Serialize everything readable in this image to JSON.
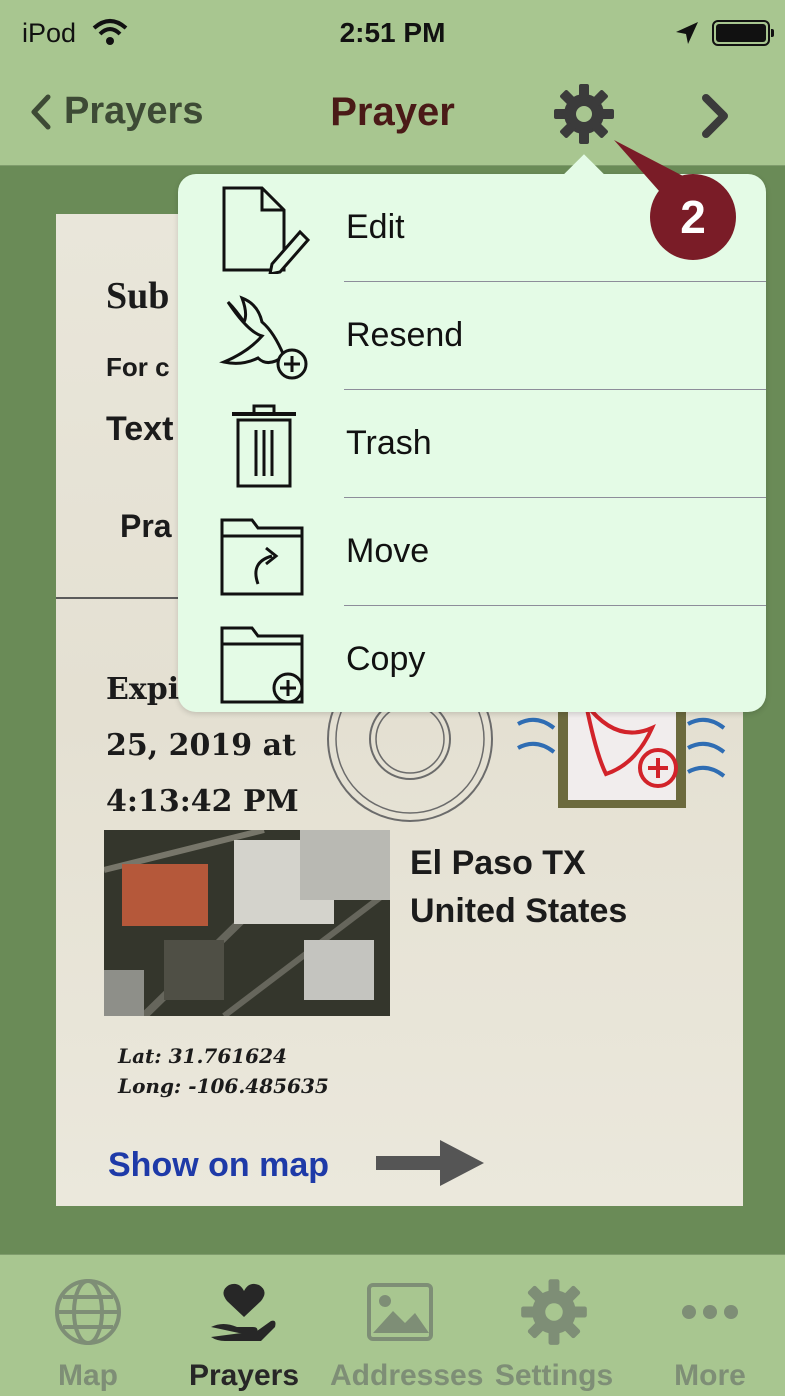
{
  "status": {
    "carrier": "iPod",
    "time": "2:51 PM"
  },
  "nav": {
    "back_label": "Prayers",
    "title": "Prayer"
  },
  "card": {
    "subject_label": "Sub",
    "for_label": "For c",
    "text_label": "Text",
    "prayer_label": "Pra",
    "expiry_line1": "Expi",
    "expiry_line2": "25, 2019 at",
    "expiry_line3": "4:13:42 PM",
    "place_line1": "El Paso TX",
    "place_line2": "United States",
    "lat": "Lat: 31.761624",
    "long": "Long: -106.485635",
    "show_on_map": "Show on map"
  },
  "menu": {
    "items": [
      {
        "label": "Edit",
        "icon": "edit-icon"
      },
      {
        "label": "Resend",
        "icon": "dove-plus-icon"
      },
      {
        "label": "Trash",
        "icon": "trash-icon"
      },
      {
        "label": "Move",
        "icon": "folder-move-icon"
      },
      {
        "label": "Copy",
        "icon": "folder-plus-icon"
      }
    ]
  },
  "callout_number": "2",
  "tabs": [
    {
      "label": "Map",
      "icon": "globe-icon"
    },
    {
      "label": "Prayers",
      "icon": "heart-hand-icon",
      "active": true
    },
    {
      "label": "Addresses",
      "icon": "image-icon"
    },
    {
      "label": "Settings",
      "icon": "gear-icon"
    },
    {
      "label": "More",
      "icon": "more-icon"
    }
  ],
  "colors": {
    "bar": "#a8c690",
    "background": "#6a8b57",
    "title": "#4a1a17",
    "popover": "#e4fbe6",
    "badge": "#7a1c27",
    "link": "#1e3aa8"
  }
}
